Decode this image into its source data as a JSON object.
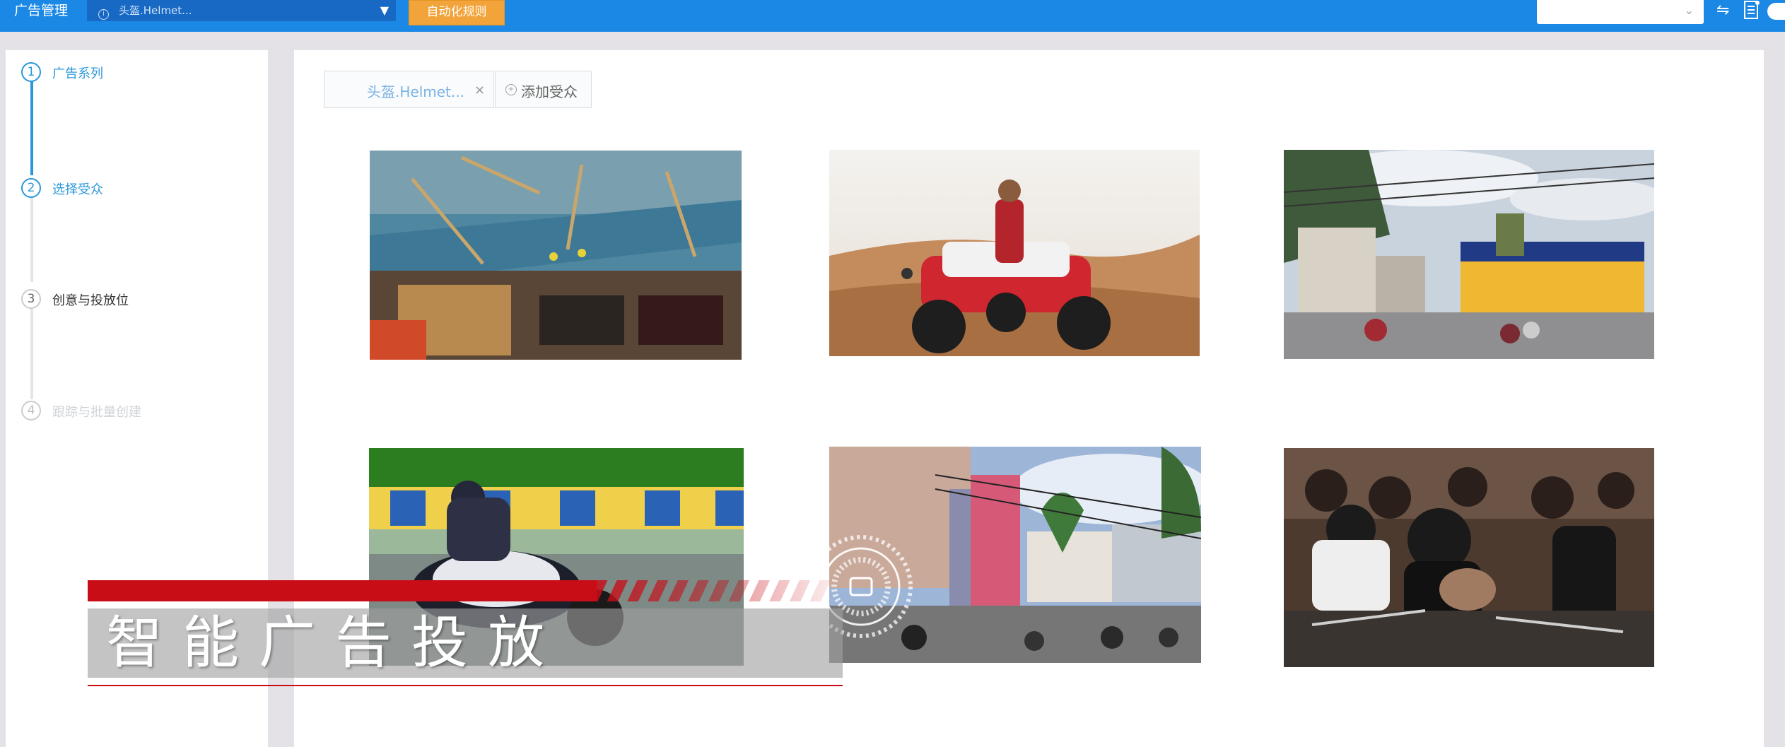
{
  "topbar": {
    "app_title": "广告管理",
    "account_select": "头盔.Helmet...",
    "auto_rules_button": "自动化规则",
    "colors": {
      "bar": "#1c88e6",
      "auto_rules": "#f2a43a"
    }
  },
  "steps": [
    {
      "number": "1",
      "label": "广告系列",
      "state": "done"
    },
    {
      "number": "2",
      "label": "选择受众",
      "state": "done"
    },
    {
      "number": "3",
      "label": "创意与投放位",
      "state": "current"
    },
    {
      "number": "4",
      "label": "跟踪与批量创建",
      "state": "disabled"
    }
  ],
  "audience_tabs": {
    "active_tab": "头盔.Helmet...",
    "close_symbol": "×",
    "add_tab": "添加受众"
  },
  "images": [
    {
      "subject": "construction site"
    },
    {
      "subject": "desert ATV rider"
    },
    {
      "subject": "street with motorbikes and shops"
    },
    {
      "subject": "motorcycle racer on track"
    },
    {
      "subject": "city street with scooters"
    },
    {
      "subject": "helmeted bikers crowd"
    }
  ],
  "overlay": {
    "caption": "智能广告投放",
    "accent_color": "#c80d17"
  }
}
